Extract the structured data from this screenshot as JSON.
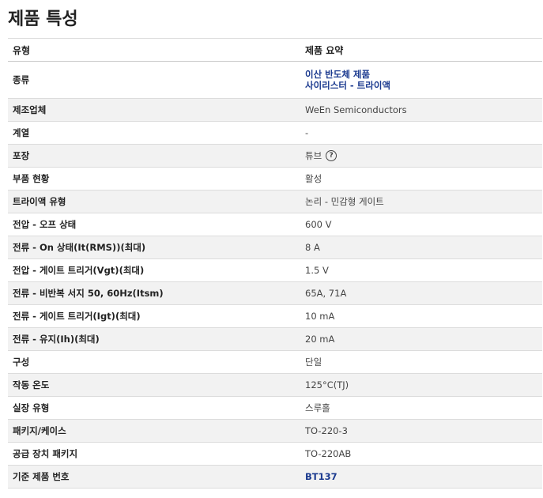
{
  "title": "제품 특성",
  "headers": {
    "type": "유형",
    "summary": "제품 요약"
  },
  "rows": [
    {
      "attr": "종류",
      "values": [
        "이산 반도체 제품",
        "사이리스터 - 트라이액"
      ],
      "link": true
    },
    {
      "attr": "제조업체",
      "values": [
        "WeEn Semiconductors"
      ]
    },
    {
      "attr": "계열",
      "values": [
        "-"
      ]
    },
    {
      "attr": "포장",
      "values": [
        "튜브"
      ],
      "help_icon": "question-circle-icon"
    },
    {
      "attr": "부품 현황",
      "values": [
        "활성"
      ]
    },
    {
      "attr": "트라이액 유형",
      "values": [
        "논리 - 민감형 게이트"
      ]
    },
    {
      "attr": "전압 - 오프 상태",
      "values": [
        "600 V"
      ]
    },
    {
      "attr": "전류 - On 상태(It(RMS))(최대)",
      "values": [
        "8 A"
      ]
    },
    {
      "attr": "전압 - 게이트 트리거(Vgt)(최대)",
      "values": [
        "1.5 V"
      ]
    },
    {
      "attr": "전류 - 비반복 서지 50, 60Hz(Itsm)",
      "values": [
        "65A, 71A"
      ]
    },
    {
      "attr": "전류 - 게이트 트리거(Igt)(최대)",
      "values": [
        "10 mA"
      ]
    },
    {
      "attr": "전류 - 유지(Ih)(최대)",
      "values": [
        "20 mA"
      ]
    },
    {
      "attr": "구성",
      "values": [
        "단일"
      ]
    },
    {
      "attr": "작동 온도",
      "values": [
        "125°C(TJ)"
      ]
    },
    {
      "attr": "실장 유형",
      "values": [
        "스루홀"
      ]
    },
    {
      "attr": "패키지/케이스",
      "values": [
        "TO-220-3"
      ]
    },
    {
      "attr": "공급 장치 패키지",
      "values": [
        "TO-220AB"
      ]
    },
    {
      "attr": "기준 제품 번호",
      "values": [
        "BT137"
      ],
      "link": true
    }
  ],
  "colors": {
    "link": "#1b3a8f",
    "stripe": "#f2f2f2",
    "border": "#dcdcdc"
  }
}
